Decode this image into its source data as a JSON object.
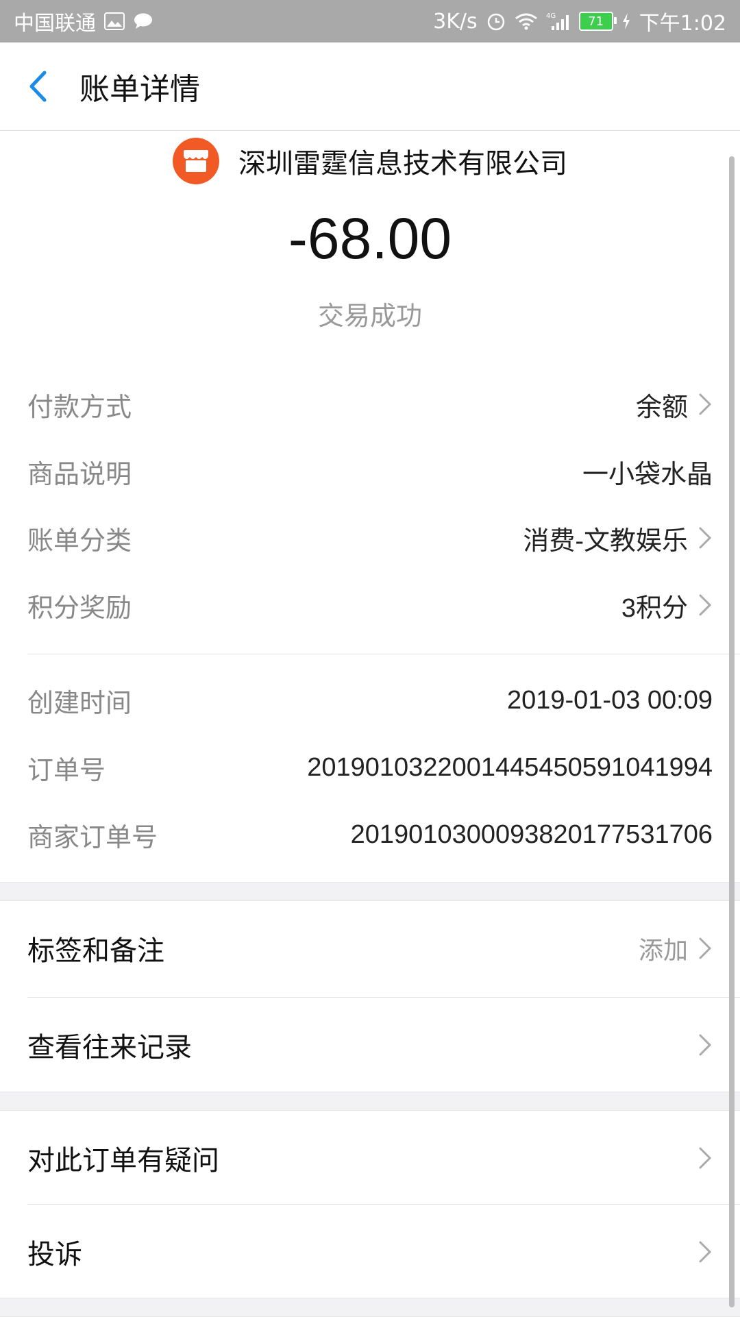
{
  "status_bar": {
    "carrier": "中国联通",
    "speed": "3K/s",
    "battery": "71",
    "time": "下午1:02"
  },
  "nav": {
    "title": "账单详情"
  },
  "merchant": {
    "name": "深圳雷霆信息技术有限公司",
    "logo_color": "#f15a24"
  },
  "amount": "-68.00",
  "transaction_status": "交易成功",
  "details": [
    {
      "label": "付款方式",
      "value": "余额"
    },
    {
      "label": "商品说明",
      "value": "一小袋水晶"
    },
    {
      "label": "账单分类",
      "value": "消费-文教娱乐"
    },
    {
      "label": "积分奖励",
      "value": "3积分"
    },
    {
      "label": "创建时间",
      "value": "2019-01-03 00:09"
    },
    {
      "label": "订单号",
      "value": "2019010322001445450591041994"
    },
    {
      "label": "商家订单号",
      "value": "2019010300093820177531706"
    }
  ],
  "actions": [
    {
      "label": "标签和备注",
      "hint": "添加"
    },
    {
      "label": "查看往来记录",
      "hint": ""
    },
    {
      "label": "对此订单有疑问",
      "hint": ""
    },
    {
      "label": "投诉",
      "hint": ""
    }
  ],
  "colors": {
    "accent_blue": "#1a8ce8",
    "status_bar_bg": "#a9a9a9",
    "band_bg": "#f2f2f5"
  }
}
